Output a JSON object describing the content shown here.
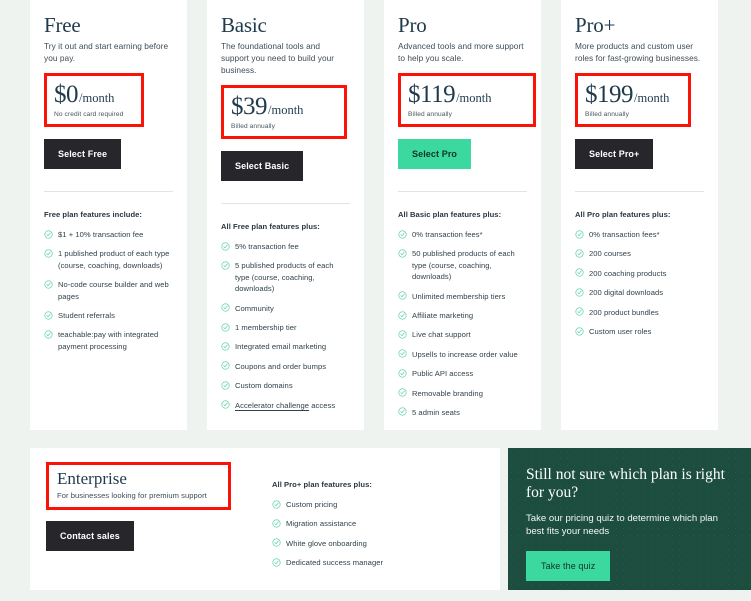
{
  "background_color": "#eef3ef",
  "accent_color": "#3bd9a0",
  "dark_button_color": "#27262b",
  "annotation_color": "#fc1308",
  "panel_color": "#1d4d3e",
  "plans": [
    {
      "name": "Free",
      "tagline": "Try it out and start earning before you pay.",
      "price": "$0",
      "period": "/month",
      "note": "No credit card required",
      "cta": "Select Free",
      "cta_style": "dark",
      "features_head": "Free plan features include:",
      "features": [
        "$1 + 10% transaction fee",
        "1 published product of each type (course, coaching, downloads)",
        "No-code course builder and web pages",
        "Student referrals",
        "teachable:pay with integrated payment processing"
      ]
    },
    {
      "name": "Basic",
      "tagline": "The foundational tools and support you need to build your business.",
      "price": "$39",
      "period": "/month",
      "note": "Billed annually",
      "cta": "Select Basic",
      "cta_style": "dark",
      "features_head": "All Free plan features plus:",
      "features": [
        "5% transaction fee",
        "5 published products of each type (course, coaching, downloads)",
        "Community",
        "1 membership tier",
        "Integrated email marketing",
        "Coupons and order bumps",
        "Custom domains",
        "Accelerator challenge access"
      ],
      "linked_feature_index": 7,
      "linked_feature_text": "Accelerator challenge"
    },
    {
      "name": "Pro",
      "tagline": "Advanced tools and more support to help you scale.",
      "price": "$119",
      "period": "/month",
      "note": "Billed annually",
      "cta": "Select Pro",
      "cta_style": "accent",
      "features_head": "All Basic plan features plus:",
      "features": [
        "0% transaction fees*",
        "50 published products of each type (course, coaching, downloads)",
        "Unlimited membership tiers",
        "Affiliate marketing",
        "Live chat support",
        "Upsells to increase order value",
        "Public API access",
        "Removable branding",
        "5 admin seats"
      ]
    },
    {
      "name": "Pro+",
      "tagline": "More products and custom user roles for fast-growing businesses.",
      "price": "$199",
      "period": "/month",
      "note": "Billed annually",
      "cta": "Select Pro+",
      "cta_style": "dark",
      "features_head": "All Pro plan features plus:",
      "features": [
        "0% transaction fees*",
        "200 courses",
        "200 coaching products",
        "200 digital downloads",
        "200 product bundles",
        "Custom user roles"
      ]
    }
  ],
  "enterprise": {
    "name": "Enterprise",
    "tagline": "For businesses looking for premium support",
    "cta": "Contact sales",
    "features_head": "All Pro+ plan features plus:",
    "features": [
      "Custom pricing",
      "Migration assistance",
      "White glove onboarding",
      "Dedicated success manager"
    ]
  },
  "quiz": {
    "title": "Still not sure which plan is right for you?",
    "subtitle": "Take our pricing quiz to determine which plan best fits your needs",
    "cta": "Take the quiz"
  }
}
